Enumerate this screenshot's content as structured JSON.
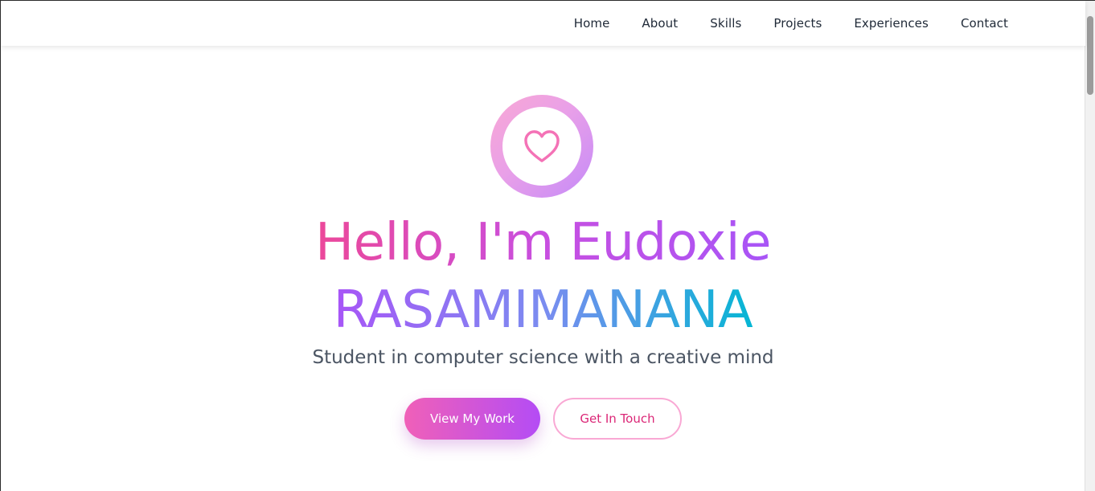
{
  "nav": {
    "items": [
      {
        "label": "Home"
      },
      {
        "label": "About"
      },
      {
        "label": "Skills"
      },
      {
        "label": "Projects"
      },
      {
        "label": "Experiences"
      },
      {
        "label": "Contact"
      }
    ]
  },
  "hero": {
    "icon": "heart-icon",
    "title_line1": "Hello, I'm Eudoxie",
    "title_line2": "RASAMIMANANA",
    "subtitle": "Student in computer science with a creative mind",
    "primary_button": "View My Work",
    "secondary_button": "Get In Touch"
  },
  "colors": {
    "pink": "#ec4899",
    "purple": "#a855f7",
    "cyan": "#06b6d4",
    "pink_light": "#f9a8d4",
    "heart": "#f472b6"
  }
}
